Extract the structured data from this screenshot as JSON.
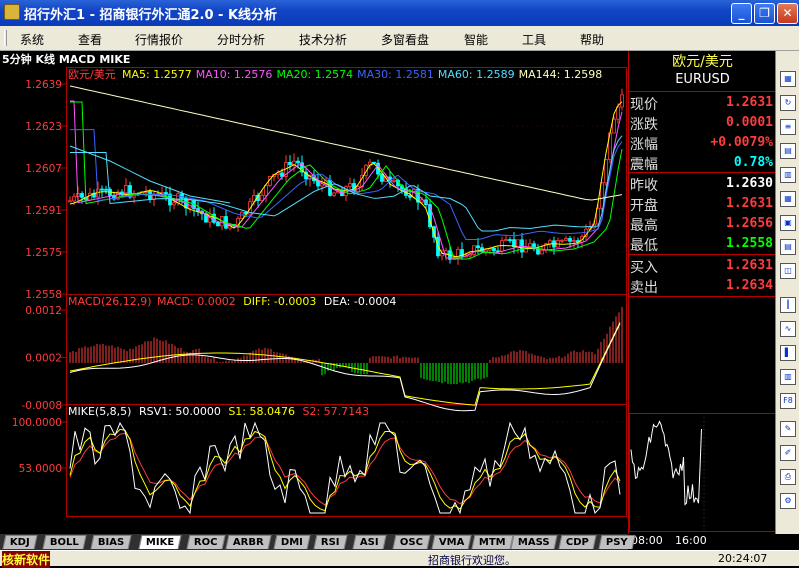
{
  "window": {
    "title": "招行外汇1 - 招商银行外汇通2.0 - K线分析"
  },
  "menu": [
    "系统",
    "查看",
    "行情报价",
    "分时分析",
    "技术分析",
    "多窗看盘",
    "智能",
    "工具",
    "帮助"
  ],
  "chart": {
    "header": "5分钟 K线 MACD MIKE",
    "price_panel": {
      "label": "欧元/美元",
      "ma": [
        {
          "name": "MA5",
          "value": "1.2577",
          "color": "#ffff00"
        },
        {
          "name": "MA10",
          "value": "1.2576",
          "color": "#ff55ff"
        },
        {
          "name": "MA20",
          "value": "1.2574",
          "color": "#00ff00"
        },
        {
          "name": "MA30",
          "value": "1.2581",
          "color": "#3c64ff"
        },
        {
          "name": "MA60",
          "value": "1.2589",
          "color": "#55ddff"
        },
        {
          "name": "MA144",
          "value": "1.2598",
          "color": "#ffffc0"
        }
      ],
      "yticks": [
        "1.2639",
        "1.2623",
        "1.2607",
        "1.2591",
        "1.2575",
        "1.2558"
      ]
    },
    "macd_panel": {
      "label": "MACD(26,12,9)",
      "macd": "MACD: 0.0002",
      "diff": "DIFF: -0.0003",
      "dea": "DEA: -0.0004",
      "yticks": [
        "0.0012",
        "0.0002",
        "-0.0008"
      ]
    },
    "mike_panel": {
      "label": "MIKE(5,8,5)",
      "rsv1": "RSV1: 50.0000",
      "s1": "S1: 58.0476",
      "s2": "S2: 57.7143",
      "yticks": [
        "100.0000",
        "53.0000"
      ]
    }
  },
  "quote": {
    "name_cn": "欧元/美元",
    "name_en": "EURUSD",
    "rows": [
      {
        "label": "现价",
        "value": "1.2631",
        "color": "#ff3c3c"
      },
      {
        "label": "涨跌",
        "value": "0.0001",
        "color": "#ff3c3c"
      },
      {
        "label": "涨幅",
        "value": "+0.0079%",
        "color": "#ff3c3c"
      },
      {
        "label": "震幅",
        "value": "0.78%",
        "color": "#00ffff"
      },
      {
        "label": "昨收",
        "value": "1.2630",
        "color": "#ffffff"
      },
      {
        "label": "开盘",
        "value": "1.2631",
        "color": "#ff3c3c"
      },
      {
        "label": "最高",
        "value": "1.2656",
        "color": "#ff3c3c"
      },
      {
        "label": "最低",
        "value": "1.2558",
        "color": "#00ff00"
      },
      {
        "label": "买入",
        "value": "1.2631",
        "color": "#ff3c3c"
      },
      {
        "label": "卖出",
        "value": "1.2634",
        "color": "#ff3c3c"
      }
    ],
    "minichart_times": [
      "08:00",
      "16:00"
    ]
  },
  "tabs": [
    "KDJ",
    "BOLL",
    "BIAS",
    "MIKE",
    "ROC",
    "ARBR",
    "DMI",
    "RSI",
    "ASI",
    "OSC",
    "VMA",
    "MTM",
    "MASS",
    "CDP",
    "PSY"
  ],
  "active_tab": "MIKE",
  "status": {
    "brand": "核新软件",
    "message": "招商银行欢迎您。",
    "time": "20:24:07"
  },
  "colors": {
    "up": "#ff3c3c",
    "down": "#00ffff",
    "grid": "#b00000",
    "macd_neg": "#00ff00"
  }
}
